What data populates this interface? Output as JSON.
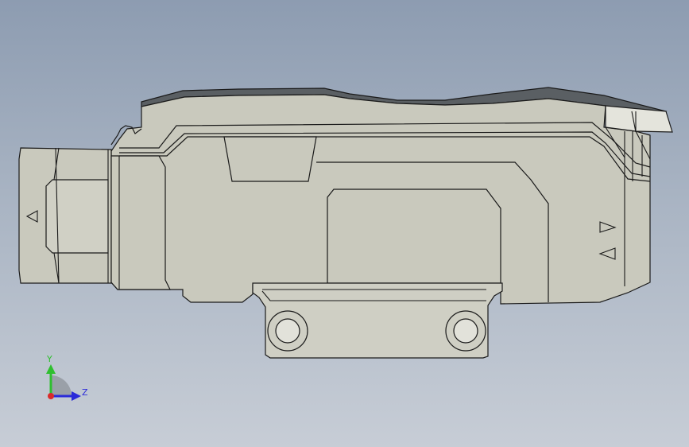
{
  "viewport": {
    "background_top": "#8d9cb1",
    "background_bottom": "#c7cdd6"
  },
  "model": {
    "body_fill": "#c9c9bd",
    "body_fill_light": "#d4d4c9",
    "edge_color": "#1a1a1a",
    "top_band": "#5a5f63"
  },
  "triad": {
    "y_label": "Y",
    "z_label": "Z",
    "y_color": "#2fbf2f",
    "z_color": "#2b2bd9",
    "x_color": "#d92b2b"
  }
}
